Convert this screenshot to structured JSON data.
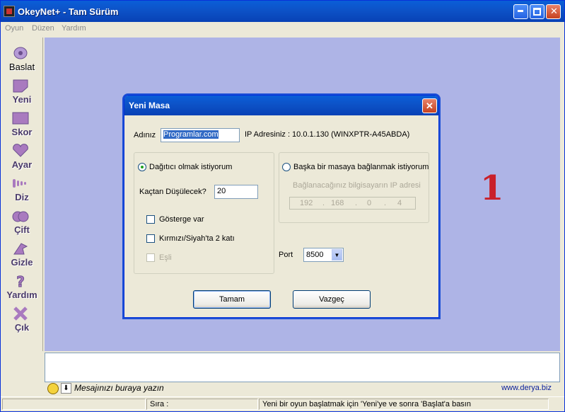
{
  "window": {
    "title": "OkeyNet+ - Tam Sürüm"
  },
  "menu": [
    "Oyun",
    "Düzen",
    "Yardım"
  ],
  "sidebar": [
    {
      "label": "Baslat",
      "icon": "spool-icon"
    },
    {
      "label": "Yeni",
      "icon": "new-table-icon"
    },
    {
      "label": "Skor",
      "icon": "score-icon"
    },
    {
      "label": "Ayar",
      "icon": "heart-icon"
    },
    {
      "label": "Diz",
      "icon": "tiles-icon"
    },
    {
      "label": "Çift",
      "icon": "pair-icon"
    },
    {
      "label": "Gizle",
      "icon": "hide-icon"
    },
    {
      "label": "Yardım",
      "icon": "question-icon"
    },
    {
      "label": "Çık",
      "icon": "x-icon"
    }
  ],
  "dialog": {
    "title": "Yeni Masa",
    "name_label": "Adınız",
    "name_value": "Programlar.com",
    "ip_info": "IP Adresiniz : 10.0.1.130 (WINXPTR-A45ABDA)",
    "radio_dealer": "Dağıtıcı olmak istiyorum",
    "radio_connect": "Başka bir masaya bağlanmak istiyorum",
    "descend_label": "Kaçtan Düşülecek?",
    "descend_value": "20",
    "connect_ip_label": "Bağlanacağınız bilgisayarın IP adresi",
    "ip_octets": [
      "192",
      "168",
      "0",
      "4"
    ],
    "ip_separator": ".",
    "chk_indicator": "Gösterge var",
    "chk_double": "Kırmızı/Siyah'ta 2 katı",
    "chk_paired": "Eşli",
    "port_label": "Port",
    "port_value": "8500",
    "ok_button": "Tamam",
    "cancel_button": "Vazgeç"
  },
  "chat": {
    "placeholder": "Mesajınızı buraya yazın",
    "link": "www.derya.biz"
  },
  "status": {
    "turn_label": "Sıra :",
    "message": "Yeni bir oyun başlatmak için 'Yeni'ye ve sonra 'Başlat'a basın"
  },
  "colors": {
    "titlebar": "#0a5ed8",
    "board": "#aeb4e6",
    "accent_red": "#c9202a"
  }
}
